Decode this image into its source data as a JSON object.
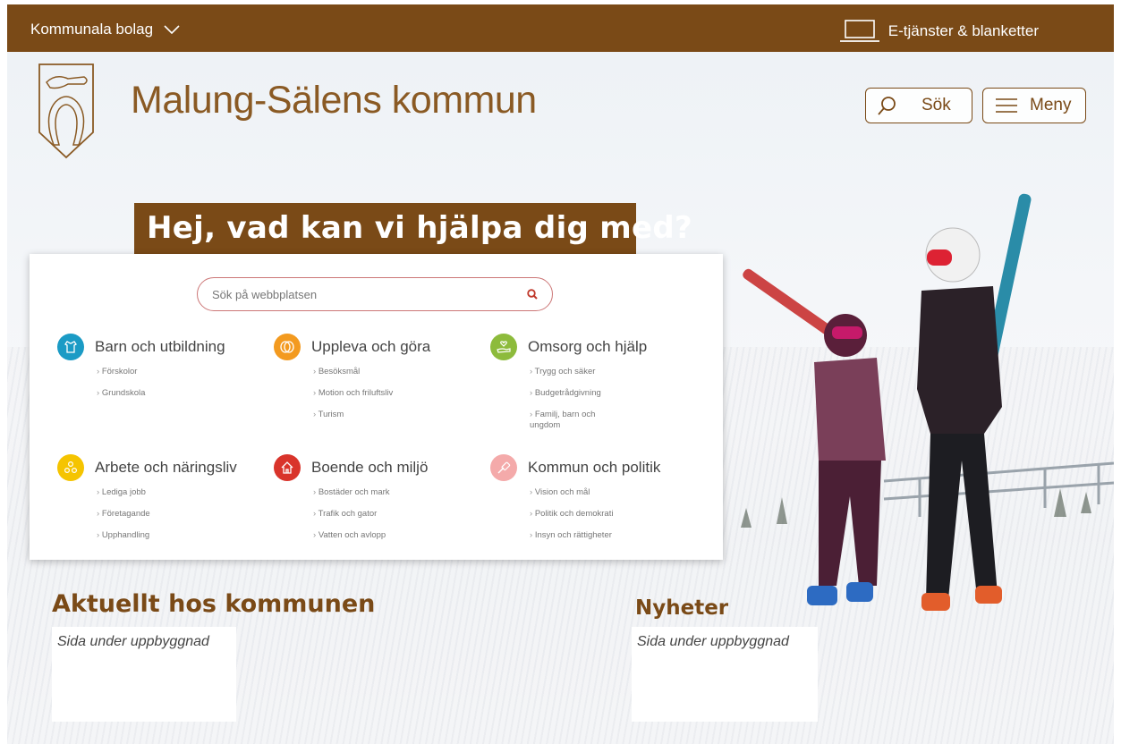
{
  "topbar": {
    "left_label": "Kommunala bolag",
    "right_label": "E-tjänster & blanketter"
  },
  "header": {
    "brand": "Malung-Sälens kommun",
    "search_label": "Sök",
    "menu_label": "Meny"
  },
  "hero": {
    "title": "Hej, vad kan vi hjälpa dig med?"
  },
  "search": {
    "placeholder": "Sök på webbplatsen"
  },
  "categories": [
    {
      "title": "Barn och utbildning",
      "color": "#1b9bc5",
      "icon": "shirt-icon",
      "links": [
        "Förskolor",
        "Grundskola"
      ]
    },
    {
      "title": "Uppleva och göra",
      "color": "#f39a1f",
      "icon": "theater-masks-icon",
      "links": [
        "Besöksmål",
        "Motion och friluftsliv",
        "Turism"
      ]
    },
    {
      "title": "Omsorg och hjälp",
      "color": "#8dbb3c",
      "icon": "heart-hand-icon",
      "links": [
        "Trygg och säker",
        "Budgetrådgivning",
        "Familj, barn och ungdom"
      ]
    },
    {
      "title": "Arbete och näringsliv",
      "color": "#f5c400",
      "icon": "people-icon",
      "links": [
        "Lediga jobb",
        "Företagande",
        "Upphandling"
      ]
    },
    {
      "title": "Boende och miljö",
      "color": "#d9342b",
      "icon": "house-icon",
      "links": [
        "Bostäder och mark",
        "Trafik och gator",
        "Vatten och avlopp"
      ]
    },
    {
      "title": "Kommun och politik",
      "color": "#f4aaaa",
      "icon": "gavel-icon",
      "links": [
        "Vision och mål",
        "Politik och demokrati",
        "Insyn och rättigheter"
      ]
    }
  ],
  "news": {
    "aktuellt_title": "Aktuellt hos kommunen",
    "aktuellt_text": "Sida under uppbyggnad",
    "nyheter_title": "Nyheter",
    "nyheter_text": "Sida under uppbyggnad"
  }
}
